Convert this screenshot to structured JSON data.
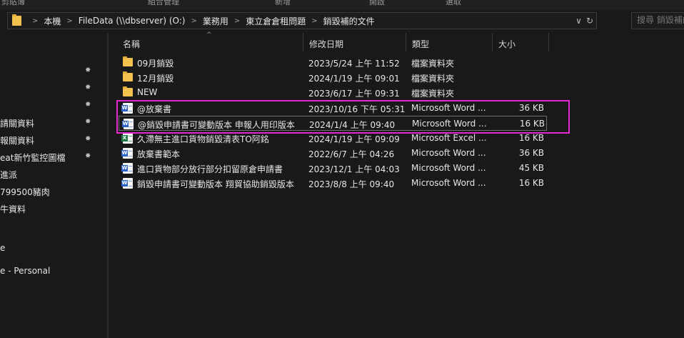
{
  "ribbon": {
    "items": [
      "剪貼簿",
      "組合管理",
      "新增",
      "開啟",
      "選取"
    ]
  },
  "address": {
    "path": [
      "本機",
      "FileData (\\\\dbserver) (O:)",
      "業務用",
      "東立倉倉租問題",
      "銷毀補的文件"
    ],
    "dropdown_glyph": "∨",
    "refresh_glyph": "↻"
  },
  "search": {
    "placeholder": "搜尋 銷毀補的文件"
  },
  "nav": {
    "items": [
      {
        "label": "",
        "pinned": true
      },
      {
        "label": "",
        "pinned": true
      },
      {
        "label": "",
        "pinned": true
      },
      {
        "label": "請關資料",
        "pinned": true
      },
      {
        "label": "報關資料",
        "pinned": true
      },
      {
        "label": "eat新竹監控圖檔",
        "pinned": true
      },
      {
        "label": "進派",
        "pinned": false
      },
      {
        "label": "799500豬肉",
        "pinned": false
      },
      {
        "label": "牛資料",
        "pinned": false
      },
      {
        "label": "",
        "pinned": false
      },
      {
        "label": "e",
        "pinned": false
      },
      {
        "label": "",
        "pinned": false
      },
      {
        "label": "e - Personal",
        "pinned": false
      }
    ]
  },
  "columns": {
    "name": "名稱",
    "date": "修改日期",
    "type": "類型",
    "size": "大小"
  },
  "files": [
    {
      "icon": "folder",
      "name": "09月銷毀",
      "date": "2023/5/24 上午 11:52",
      "type": "檔案資料夾",
      "size": ""
    },
    {
      "icon": "folder",
      "name": "12月銷毀",
      "date": "2024/1/19 上午 09:01",
      "type": "檔案資料夾",
      "size": ""
    },
    {
      "icon": "folder",
      "name": "NEW",
      "date": "2023/6/17 上午 09:31",
      "type": "檔案資料夾",
      "size": ""
    },
    {
      "icon": "word",
      "name": "@放棄書",
      "date": "2023/10/16 下午 05:31",
      "type": "Microsoft Word ...",
      "size": "36 KB"
    },
    {
      "icon": "word",
      "name": "@銷毀申請書可變動版本 申報人用印版本",
      "date": "2024/1/4 上午 09:40",
      "type": "Microsoft Word ...",
      "size": "16 KB",
      "selected": true
    },
    {
      "icon": "excel",
      "name": "久滯無主進口貨物銷毀清表TO阿銘",
      "date": "2024/1/19 上午 09:09",
      "type": "Microsoft Excel ...",
      "size": "16 KB"
    },
    {
      "icon": "word",
      "name": "放棄書範本",
      "date": "2022/6/7 上午 04:26",
      "type": "Microsoft Word ...",
      "size": "36 KB"
    },
    {
      "icon": "word",
      "name": "進口貨物部分放行部分扣留原倉申請書",
      "date": "2023/12/1 上午 04:03",
      "type": "Microsoft Word ...",
      "size": "45 KB"
    },
    {
      "icon": "word",
      "name": "銷毀申請書可變動版本 翔貿協助銷毀版本",
      "date": "2023/8/8 上午 09:40",
      "type": "Microsoft Word ...",
      "size": "16 KB"
    }
  ],
  "colors": {
    "highlight": "#e329cf",
    "folder": "#f2c14e",
    "word": "#2b63c6",
    "excel": "#1f7a45"
  }
}
